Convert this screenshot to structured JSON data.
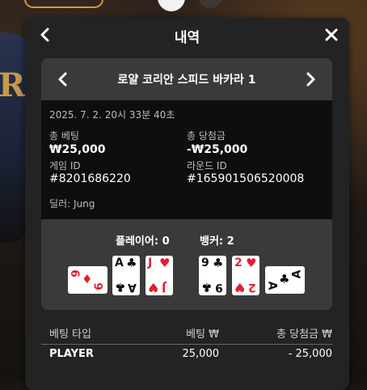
{
  "header": {
    "title": "내역",
    "back_icon": "chevron-left-icon",
    "close_icon": "close-icon"
  },
  "game": {
    "title": "로얄 코리안 스피드 바카라 1",
    "prev_icon": "chevron-left-icon",
    "next_icon": "chevron-right-icon"
  },
  "info": {
    "datetime": "2025. 7. 2. 20시 33분 40초",
    "total_bet_label": "총 베팅",
    "total_bet_value": "₩25,000",
    "total_win_label": "총 당첨금",
    "total_win_value": "-₩25,000",
    "game_id_label": "게임 ID",
    "game_id_value": "#8201686220",
    "round_id_label": "라운드 ID",
    "round_id_value": "#165901506520008",
    "dealer": "딜러: Jung"
  },
  "result": {
    "player_label": "플레이어: 0",
    "banker_label": "뱅커: 2",
    "player_cards": [
      {
        "rank": "6",
        "suit": "♦",
        "color": "#e3202f",
        "orientation": "horizontal"
      },
      {
        "rank": "A",
        "suit": "♣",
        "color": "#111111",
        "orientation": "vertical"
      },
      {
        "rank": "J",
        "suit": "♥",
        "color": "#e3202f",
        "orientation": "vertical"
      }
    ],
    "banker_cards": [
      {
        "rank": "9",
        "suit": "♣",
        "color": "#111111",
        "orientation": "vertical"
      },
      {
        "rank": "2",
        "suit": "♥",
        "color": "#e3202f",
        "orientation": "vertical"
      },
      {
        "rank": "A",
        "suit": "♣",
        "color": "#111111",
        "orientation": "horizontal"
      }
    ]
  },
  "summary": {
    "col_type": "베팅 타입",
    "col_bet": "베팅 ₩",
    "col_win": "총 당첨금 ₩",
    "rows": [
      {
        "type": "PLAYER",
        "bet": "25,000",
        "win": "- 25,000"
      }
    ]
  },
  "colors": {
    "modal_bg": "#232323",
    "panel_bg": "#3a3a3a",
    "info_bg": "#0e0e0e",
    "red_suit": "#e3202f"
  }
}
